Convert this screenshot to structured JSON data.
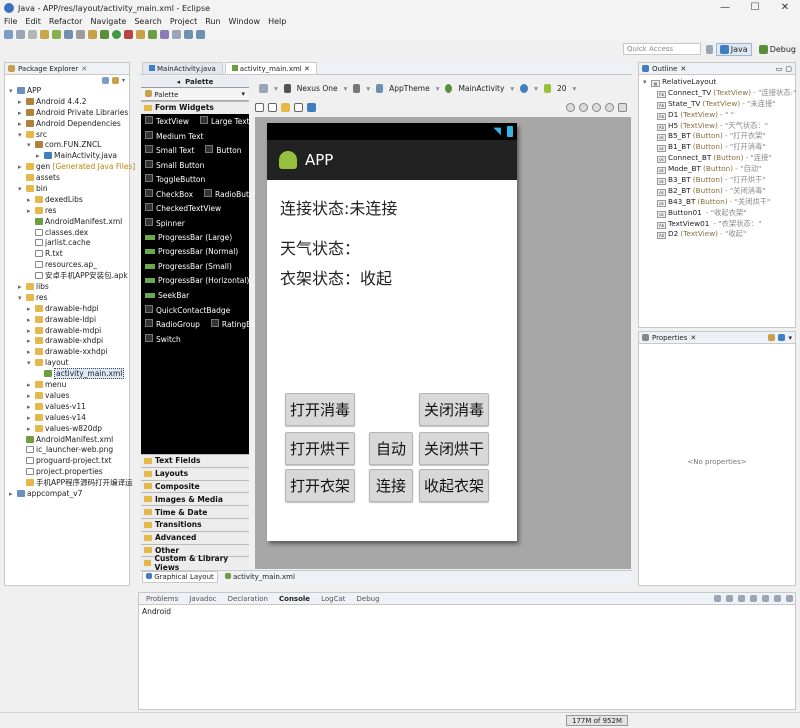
{
  "window": {
    "title": "Java - APP/res/layout/activity_main.xml - Eclipse",
    "controls": [
      "—",
      "☐",
      "✕"
    ]
  },
  "menu": [
    "File",
    "Edit",
    "Refactor",
    "Navigate",
    "Search",
    "Project",
    "Run",
    "Window",
    "Help"
  ],
  "quick_access": {
    "placeholder": "Quick Access"
  },
  "perspectives": [
    {
      "label": "Java",
      "active": true
    },
    {
      "label": "Debug",
      "active": false
    }
  ],
  "package_explorer": {
    "title": "Package Explorer",
    "items": [
      {
        "label": "APP",
        "depth": 0,
        "twisty": "▾",
        "icon": "proj"
      },
      {
        "label": "Android 4.4.2",
        "depth": 1,
        "twisty": "▸",
        "icon": "pkg"
      },
      {
        "label": "Android Private Libraries",
        "depth": 1,
        "twisty": "▸",
        "icon": "pkg"
      },
      {
        "label": "Android Dependencies",
        "depth": 1,
        "twisty": "▸",
        "icon": "pkg"
      },
      {
        "label": "src",
        "depth": 1,
        "twisty": "▾",
        "icon": "folder"
      },
      {
        "label": "com.FUN.ZNCL",
        "depth": 2,
        "twisty": "▾",
        "icon": "pkg"
      },
      {
        "label": "MainActivity.java",
        "depth": 3,
        "twisty": "▸",
        "icon": "java"
      },
      {
        "label": "gen",
        "suffix": " [Generated Java Files]",
        "depth": 1,
        "twisty": "▸",
        "icon": "folder"
      },
      {
        "label": "assets",
        "depth": 1,
        "twisty": "",
        "icon": "folder"
      },
      {
        "label": "bin",
        "depth": 1,
        "twisty": "▾",
        "icon": "folder"
      },
      {
        "label": "dexedLibs",
        "depth": 2,
        "twisty": "▸",
        "icon": "folder"
      },
      {
        "label": "res",
        "depth": 2,
        "twisty": "▸",
        "icon": "folder"
      },
      {
        "label": "AndroidManifest.xml",
        "depth": 2,
        "twisty": "",
        "icon": "xmlf"
      },
      {
        "label": "classes.dex",
        "depth": 2,
        "twisty": "",
        "icon": "file"
      },
      {
        "label": "jarlist.cache",
        "depth": 2,
        "twisty": "",
        "icon": "file"
      },
      {
        "label": "R.txt",
        "depth": 2,
        "twisty": "",
        "icon": "file"
      },
      {
        "label": "resources.ap_",
        "depth": 2,
        "twisty": "",
        "icon": "file"
      },
      {
        "label": "安卓手机APP安装包.apk",
        "depth": 2,
        "twisty": "",
        "icon": "file"
      },
      {
        "label": "libs",
        "depth": 1,
        "twisty": "▸",
        "icon": "folder"
      },
      {
        "label": "res",
        "depth": 1,
        "twisty": "▾",
        "icon": "folder"
      },
      {
        "label": "drawable-hdpi",
        "depth": 2,
        "twisty": "▸",
        "icon": "folder"
      },
      {
        "label": "drawable-ldpi",
        "depth": 2,
        "twisty": "▸",
        "icon": "folder"
      },
      {
        "label": "drawable-mdpi",
        "depth": 2,
        "twisty": "▸",
        "icon": "folder"
      },
      {
        "label": "drawable-xhdpi",
        "depth": 2,
        "twisty": "▸",
        "icon": "folder"
      },
      {
        "label": "drawable-xxhdpi",
        "depth": 2,
        "twisty": "▸",
        "icon": "folder"
      },
      {
        "label": "layout",
        "depth": 2,
        "twisty": "▾",
        "icon": "folder"
      },
      {
        "label": "activity_main.xml",
        "depth": 3,
        "twisty": "",
        "icon": "xmlf",
        "selected": true
      },
      {
        "label": "menu",
        "depth": 2,
        "twisty": "▸",
        "icon": "folder"
      },
      {
        "label": "values",
        "depth": 2,
        "twisty": "▸",
        "icon": "folder"
      },
      {
        "label": "values-v11",
        "depth": 2,
        "twisty": "▸",
        "icon": "folder"
      },
      {
        "label": "values-v14",
        "depth": 2,
        "twisty": "▸",
        "icon": "folder"
      },
      {
        "label": "values-w820dp",
        "depth": 2,
        "twisty": "▸",
        "icon": "folder"
      },
      {
        "label": "AndroidManifest.xml",
        "depth": 1,
        "twisty": "",
        "icon": "xmlf"
      },
      {
        "label": "ic_launcher-web.png",
        "depth": 1,
        "twisty": "",
        "icon": "file"
      },
      {
        "label": "proguard-project.txt",
        "depth": 1,
        "twisty": "",
        "icon": "file"
      },
      {
        "label": "project.properties",
        "depth": 1,
        "twisty": "",
        "icon": "file"
      },
      {
        "label": "手机APP程序源码打开编译运",
        "depth": 1,
        "twisty": "",
        "icon": "folder"
      },
      {
        "label": "appcompat_v7",
        "depth": 0,
        "twisty": "▸",
        "icon": "proj"
      }
    ]
  },
  "editor": {
    "tabs": [
      {
        "label": "MainActivity.java",
        "selected": false
      },
      {
        "label": "activity_main.xml",
        "selected": true
      }
    ],
    "bottom_tabs": [
      {
        "label": "Graphical Layout",
        "selected": true
      },
      {
        "label": "activity_main.xml",
        "selected": false
      }
    ],
    "device": "Nexus One",
    "theme": "AppTheme",
    "activity": "MainActivity",
    "api": "20"
  },
  "palette": {
    "title": "Palette",
    "search": "Palette",
    "open_category": "Form Widgets",
    "widgets": [
      [
        "TextView",
        "Large Text"
      ],
      [
        "Medium Text"
      ],
      [
        "Small Text",
        "Button"
      ],
      [
        "Small Button"
      ],
      [
        "ToggleButton"
      ],
      [
        "CheckBox",
        "RadioButton"
      ],
      [
        "CheckedTextView"
      ],
      [
        "Spinner"
      ],
      [
        "ProgressBar (Large)"
      ],
      [
        "ProgressBar (Normal)"
      ],
      [
        "ProgressBar (Small)"
      ],
      [
        "ProgressBar (Horizontal)"
      ],
      [
        "SeekBar"
      ],
      [
        "QuickContactBadge"
      ],
      [
        "RadioGroup",
        "RatingBar"
      ],
      [
        "Switch"
      ]
    ],
    "categories": [
      "Text Fields",
      "Layouts",
      "Composite",
      "Images & Media",
      "Time & Date",
      "Transitions",
      "Advanced",
      "Other",
      "Custom & Library Views"
    ]
  },
  "app": {
    "title": "APP",
    "connect_status": "连接状态:未连接",
    "weather_status": "天气状态：",
    "rack_status": "衣架状态：收起",
    "buttons": {
      "disinfect_on": "打开消毒",
      "disinfect_off": "关闭消毒",
      "dry_on": "打开烘干",
      "auto": "自动",
      "dry_off": "关闭烘干",
      "rack_open": "打开衣架",
      "connect": "连接",
      "rack_close": "收起衣架"
    }
  },
  "outline": {
    "title": "Outline",
    "root": "RelativeLayout",
    "items": [
      {
        "id": "Connect_TV",
        "type": "(TextView)",
        "text": "- \"连接状态:\""
      },
      {
        "id": "State_TV",
        "type": "(TextView)",
        "text": "- \"未连接\""
      },
      {
        "id": "D1",
        "type": "(TextView)",
        "text": "- \" \""
      },
      {
        "id": "H5",
        "type": "(TextView)",
        "text": "- \"天气状态：\""
      },
      {
        "id": "B5_BT",
        "type": "(Button)",
        "text": "- \"打开衣架\""
      },
      {
        "id": "B1_BT",
        "type": "(Button)",
        "text": "- \"打开消毒\""
      },
      {
        "id": "Connect_BT",
        "type": "(Button)",
        "text": "- \"连接\""
      },
      {
        "id": "Mode_BT",
        "type": "(Button)",
        "text": "- \"自动\""
      },
      {
        "id": "B3_BT",
        "type": "(Button)",
        "text": "- \"打开烘干\""
      },
      {
        "id": "B2_BT",
        "type": "(Button)",
        "text": "- \"关闭消毒\""
      },
      {
        "id": "B43_BT",
        "type": "(Button)",
        "text": "- \"关闭烘干\""
      },
      {
        "id": "Button01",
        "type": "",
        "text": "- \"收起衣架\""
      },
      {
        "id": "TextView01",
        "type": "",
        "text": "- \"衣架状态：\""
      },
      {
        "id": "D2",
        "type": "(TextView)",
        "text": "- \"收起\""
      }
    ]
  },
  "properties": {
    "title": "Properties",
    "empty": "<No properties>"
  },
  "console": {
    "tabs": [
      {
        "label": "Problems",
        "selected": false
      },
      {
        "label": "Javadoc",
        "selected": false
      },
      {
        "label": "Declaration",
        "selected": false
      },
      {
        "label": "Console",
        "selected": true
      },
      {
        "label": "LogCat",
        "selected": false
      },
      {
        "label": "Debug",
        "selected": false
      }
    ],
    "content": "Android"
  },
  "status": {
    "memory": "177M of 952M"
  }
}
